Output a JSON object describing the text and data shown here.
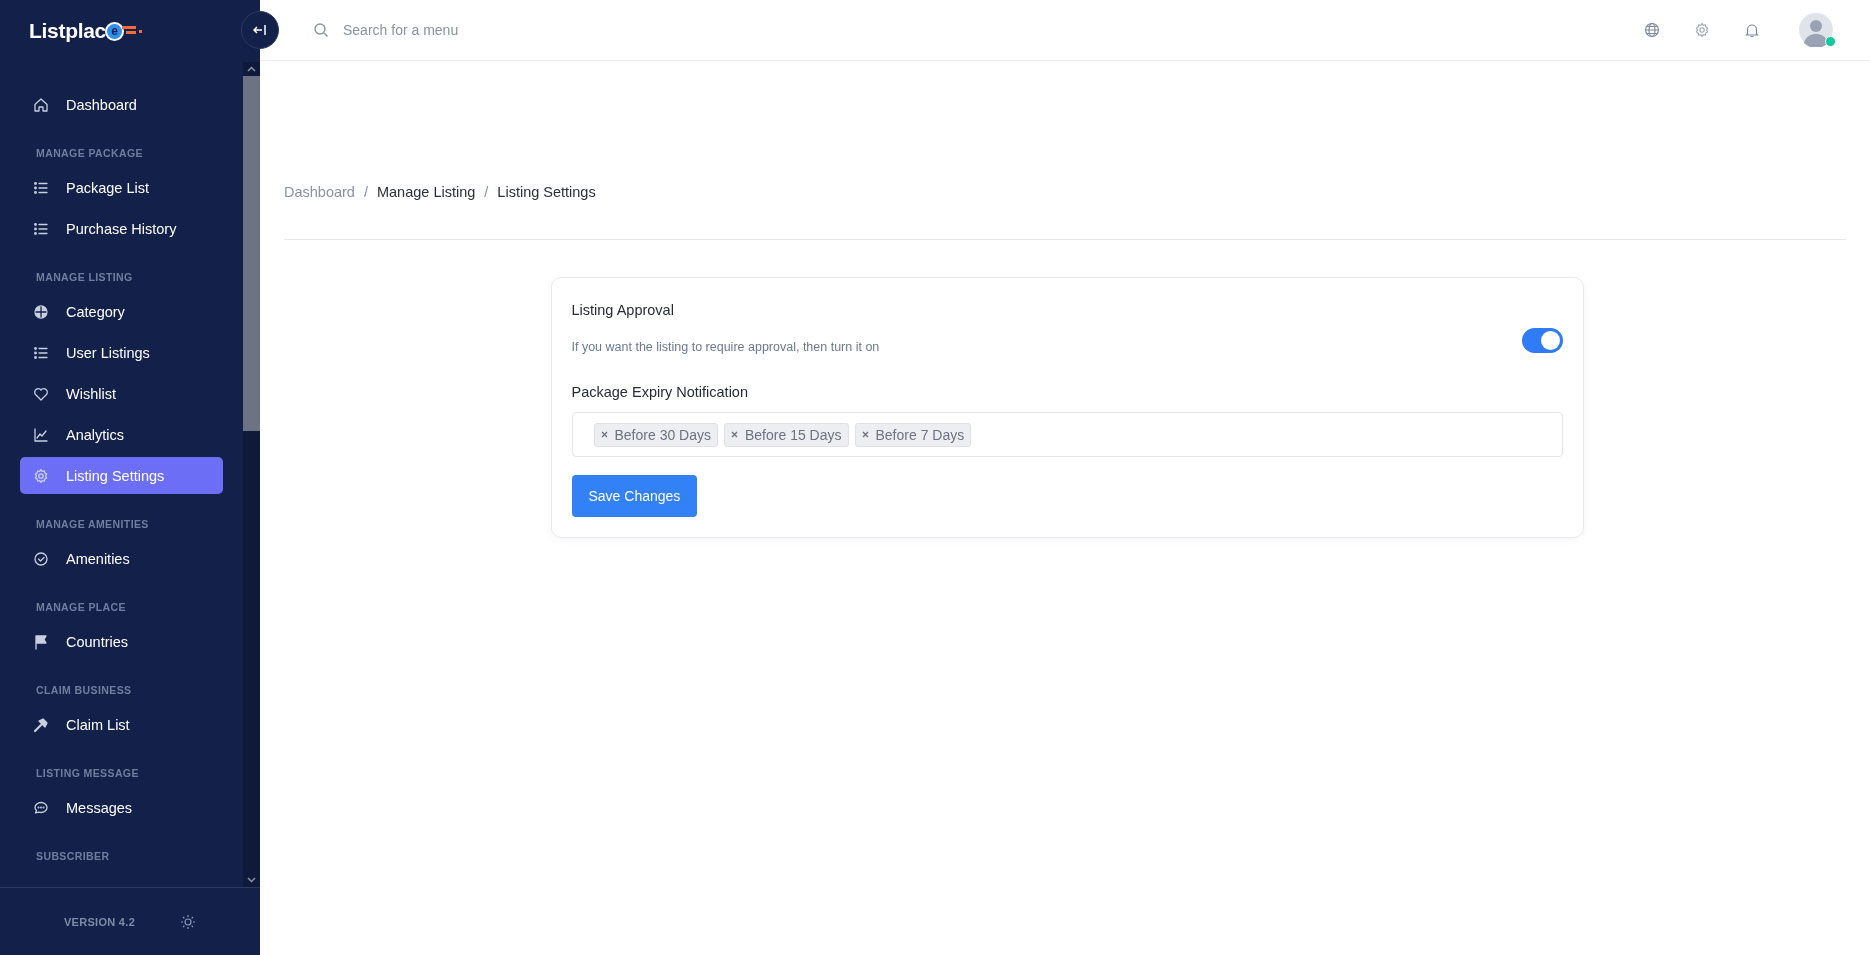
{
  "logo": {
    "text": "Listplac",
    "badge": "e"
  },
  "sidebar": {
    "sections": [
      {
        "items": [
          {
            "label": "Dashboard",
            "selected": false
          }
        ]
      },
      {
        "heading": "MANAGE PACKAGE",
        "items": [
          {
            "label": "Package List",
            "selected": false
          },
          {
            "label": "Purchase History",
            "selected": false
          }
        ]
      },
      {
        "heading": "MANAGE LISTING",
        "items": [
          {
            "label": "Category",
            "selected": false
          },
          {
            "label": "User Listings",
            "selected": false
          },
          {
            "label": "Wishlist",
            "selected": false
          },
          {
            "label": "Analytics",
            "selected": false
          },
          {
            "label": "Listing Settings",
            "selected": true
          }
        ]
      },
      {
        "heading": "MANAGE AMENITIES",
        "items": [
          {
            "label": "Amenities",
            "selected": false
          }
        ]
      },
      {
        "heading": "MANAGE PLACE",
        "items": [
          {
            "label": "Countries",
            "selected": false
          }
        ]
      },
      {
        "heading": "CLAIM BUSINESS",
        "items": [
          {
            "label": "Claim List",
            "selected": false
          }
        ]
      },
      {
        "heading": "LISTING MESSAGE",
        "items": [
          {
            "label": "Messages",
            "selected": false
          }
        ]
      },
      {
        "heading": "SUBSCRIBER"
      }
    ],
    "version": "VERSION 4.2"
  },
  "search": {
    "placeholder": "Search for a menu"
  },
  "user": {
    "online": true
  },
  "breadcrumb": {
    "separator": "/",
    "items": [
      {
        "label": "Dashboard",
        "link": true
      },
      {
        "label": "Manage Listing",
        "link": false
      },
      {
        "label": "Listing Settings",
        "link": false
      }
    ]
  },
  "settings": {
    "approval_title": "Listing Approval",
    "approval_help": "If you want the listing to require approval, then turn it on",
    "approval_on": true,
    "expiry_label": "Package Expiry Notification",
    "expiry_tags": [
      "Before 30 Days",
      "Before 15 Days",
      "Before 7 Days"
    ],
    "save": "Save Changes"
  }
}
